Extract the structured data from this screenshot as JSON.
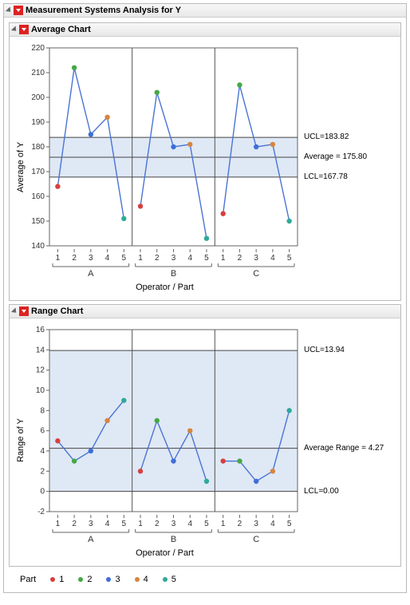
{
  "main_title": "Measurement Systems Analysis for Y",
  "avg_section_title": "Average Chart",
  "range_section_title": "Range Chart",
  "xlabel": "Operator / Part",
  "legend_label": "Part",
  "legend_items": [
    "1",
    "2",
    "3",
    "4",
    "5"
  ],
  "part_colors": {
    "1": "#d6403f",
    "2": "#45a843",
    "3": "#3f6fd6",
    "4": "#d6853f",
    "5": "#2fa99a"
  },
  "operators": [
    "A",
    "B",
    "C"
  ],
  "annotations": {
    "avg_ucl": "UCL=183.82",
    "avg_mean": "Average = 175.80",
    "avg_lcl": "LCL=167.78",
    "range_ucl": "UCL=13.94",
    "range_mean": "Average Range = 4.27",
    "range_lcl": "LCL=0.00"
  },
  "chart_data": [
    {
      "type": "line",
      "title": "Average Chart",
      "ylabel": "Average of Y",
      "xlabel": "Operator / Part",
      "ylim": [
        140,
        220
      ],
      "yticks": [
        140,
        150,
        160,
        170,
        180,
        190,
        200,
        210,
        220
      ],
      "groups": [
        "A",
        "B",
        "C"
      ],
      "parts": [
        1,
        2,
        3,
        4,
        5
      ],
      "lines": {
        "ucl": 183.82,
        "center": 175.8,
        "lcl": 167.78
      },
      "series": [
        {
          "name": "A",
          "x": [
            1,
            2,
            3,
            4,
            5
          ],
          "values": [
            164,
            212,
            185,
            192,
            151
          ]
        },
        {
          "name": "B",
          "x": [
            1,
            2,
            3,
            4,
            5
          ],
          "values": [
            156,
            202,
            180,
            181,
            143
          ]
        },
        {
          "name": "C",
          "x": [
            1,
            2,
            3,
            4,
            5
          ],
          "values": [
            153,
            205,
            180,
            181,
            150
          ]
        }
      ]
    },
    {
      "type": "line",
      "title": "Range Chart",
      "ylabel": "Range of Y",
      "xlabel": "Operator / Part",
      "ylim": [
        -2,
        16
      ],
      "yticks": [
        -2,
        0,
        2,
        4,
        6,
        8,
        10,
        12,
        14,
        16
      ],
      "groups": [
        "A",
        "B",
        "C"
      ],
      "parts": [
        1,
        2,
        3,
        4,
        5
      ],
      "lines": {
        "ucl": 13.94,
        "center": 4.27,
        "lcl": 0.0
      },
      "series": [
        {
          "name": "A",
          "x": [
            1,
            2,
            3,
            4,
            5
          ],
          "values": [
            5,
            3,
            4,
            7,
            9
          ]
        },
        {
          "name": "B",
          "x": [
            1,
            2,
            3,
            4,
            5
          ],
          "values": [
            2,
            7,
            3,
            6,
            1
          ]
        },
        {
          "name": "C",
          "x": [
            1,
            2,
            3,
            4,
            5
          ],
          "values": [
            3,
            3,
            1,
            2,
            8
          ]
        }
      ]
    }
  ]
}
